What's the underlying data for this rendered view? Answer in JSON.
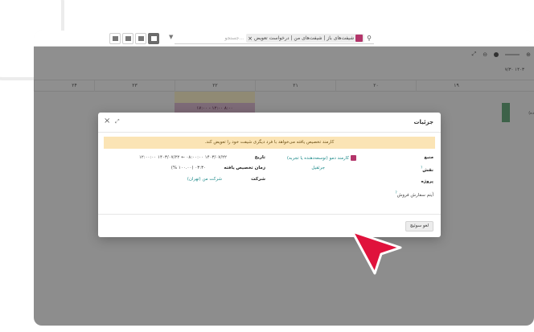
{
  "toolbar": {
    "search_facet": "شیفت‌های باز | شیفت‌های من | درخواست تعویض",
    "search_placeholder": "جستجو..."
  },
  "gantt": {
    "current_date": "۷/۳۰ ۱۴۰۳",
    "days": [
      "۲۴",
      "۲۳",
      "۲۲",
      "۲۱",
      "۲۰",
      "۱۹"
    ],
    "shift_label": "۱۷:۰۰ - ۱۲:۰۰ ۸:۰۰",
    "right_edge": "(ده"
  },
  "modal": {
    "title": "جزئیات",
    "alert": "کارمند تخصیص یافته می‌خواهد با فرد دیگری شیفت خود را تعویض کند.",
    "fields": {
      "source_label": "منبع",
      "source_value": "کارمند دمو (توسعه‌دهنده یا تجربه)",
      "role_label": "نقش",
      "role_value": "جرثقیل",
      "project_label": "پروژه",
      "sales_order_label": "آیتم سفارش فروش",
      "date_label": "تاریخ",
      "date_value": "۱۴۰۳/۰۷/۲۲ ۰۸:۰۰:۰۰ ← ۱۴۰۳/۰۷/۲۲ ۱۲:۰۰:۰۰",
      "allocated_time_label": "زمان تخصیص یافته",
      "allocated_time_value": "۰۳:۳۰ (۱۰۰.۰۰ %)",
      "company_label": "شرکت",
      "company_value": "شرکت من (تهران)"
    },
    "footer_button": "لغو سوئیچ",
    "question_mark": "?"
  },
  "colors": {
    "cursor": "#e0123c",
    "accent": "#b3356a",
    "link": "#1d8a8a",
    "alert_bg": "#fbe4b5"
  }
}
